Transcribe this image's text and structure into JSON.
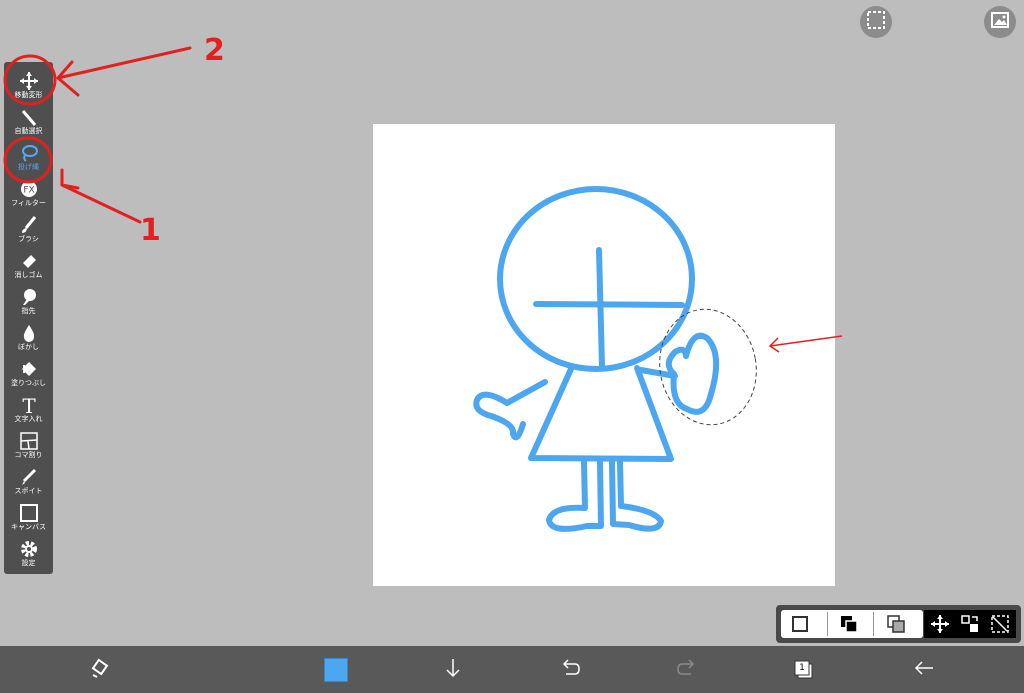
{
  "toolbar": {
    "tools": [
      {
        "label": "移動変形",
        "icon": "move-icon"
      },
      {
        "label": "自動選択",
        "icon": "magic-wand-icon"
      },
      {
        "label": "投げ縄",
        "icon": "lasso-icon",
        "active": true
      },
      {
        "label": "フィルター",
        "icon": "fx-icon",
        "icon_text": "FX"
      },
      {
        "label": "ブラシ",
        "icon": "brush-icon"
      },
      {
        "label": "消しゴム",
        "icon": "eraser-icon"
      },
      {
        "label": "指先",
        "icon": "finger-icon"
      },
      {
        "label": "ぼかし",
        "icon": "blur-drop-icon"
      },
      {
        "label": "塗りつぶし",
        "icon": "fill-bucket-icon"
      },
      {
        "label": "文字入れ",
        "icon": "text-icon",
        "icon_text": "T"
      },
      {
        "label": "コマ割り",
        "icon": "panel-divide-icon"
      },
      {
        "label": "スポイト",
        "icon": "eyedropper-icon"
      },
      {
        "label": "キャンバス",
        "icon": "canvas-icon"
      },
      {
        "label": "設定",
        "icon": "gear-icon"
      }
    ]
  },
  "top_right": {
    "selection_icon": "selection-icon",
    "image_icon": "image-icon"
  },
  "bottom_bar": {
    "current_color": "#4da6f0",
    "layer_count": "1",
    "icons": [
      "transform-rotate-icon",
      "color-swatch",
      "download-arrow-icon",
      "undo-icon",
      "redo-icon",
      "layers-icon",
      "back-arrow-icon"
    ]
  },
  "layer_panel": {
    "icons": [
      "white-square-icon",
      "overlap-squares-icon",
      "overlap-squares-light-icon",
      "move-icon",
      "transform-select-icon",
      "selection-dashed-icon"
    ]
  },
  "annotations": {
    "label_1": "1",
    "label_2": "2"
  },
  "colors": {
    "background": "#bdbdbd",
    "toolbar": "#4f4f4f",
    "drawing": "#4da6f0",
    "annotation": "#e32020",
    "active_tool": "#5aa9f0"
  }
}
